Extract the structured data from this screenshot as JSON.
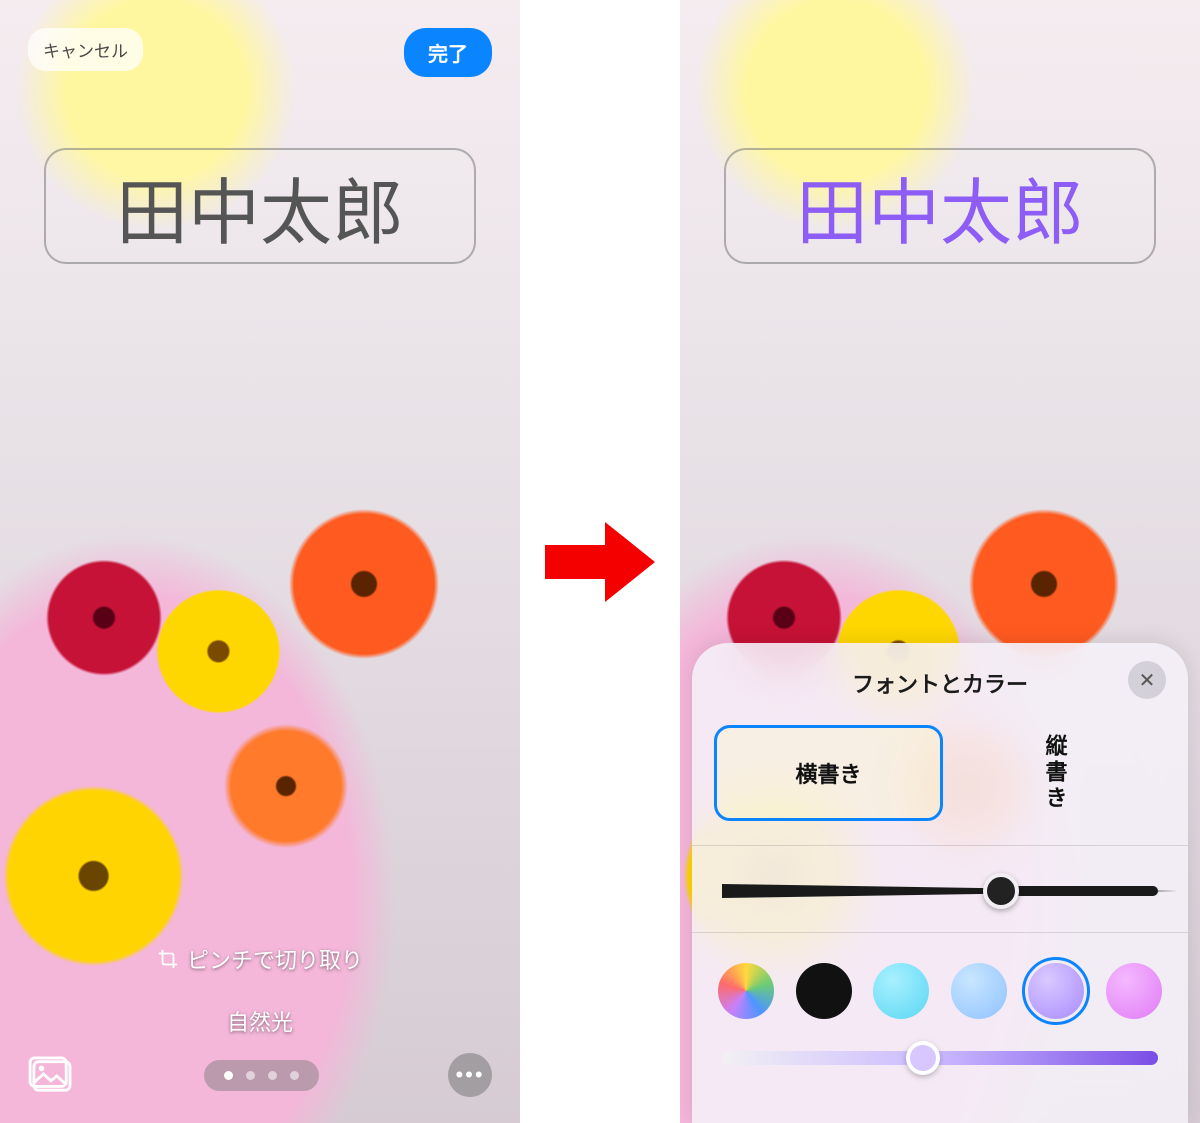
{
  "left": {
    "cancel": "キャンセル",
    "done": "完了",
    "name": "田中太郎",
    "crop_hint": "ピンチで切り取り",
    "filter": "自然光"
  },
  "right": {
    "name": "田中太郎",
    "panel_title": "フォントとカラー",
    "orientation": {
      "horizontal": "横書き",
      "vertical": "縦書き",
      "selected": "horizontal"
    },
    "weight_slider": {
      "position_pct": 64
    },
    "swatches": [
      {
        "id": "rainbow",
        "selected": false
      },
      {
        "id": "black",
        "selected": false
      },
      {
        "id": "cyan",
        "selected": false
      },
      {
        "id": "lightblue",
        "selected": false
      },
      {
        "id": "purple",
        "selected": true
      },
      {
        "id": "pink",
        "selected": false
      }
    ],
    "hue_slider": {
      "position_pct": 46
    }
  },
  "colors": {
    "accent": "#0a84ff",
    "name_purple": "#8d5df6",
    "arrow": "#f40000"
  }
}
